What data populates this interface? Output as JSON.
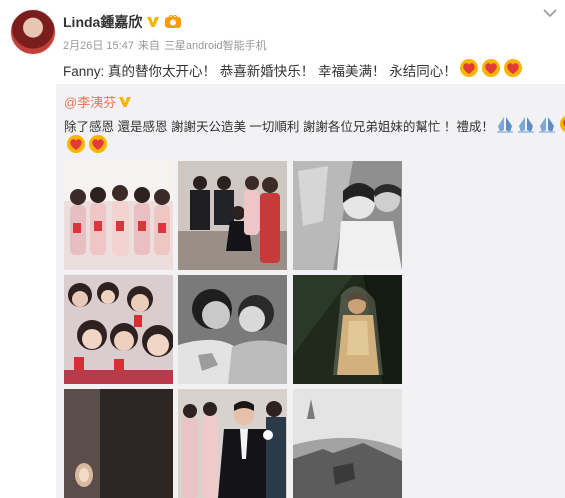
{
  "post": {
    "username": "Linda鍾嘉欣",
    "date": "2月26日 15:47",
    "source_prefix": "来自",
    "source_device": "三星android智能手机",
    "text": "Fanny: 真的替你太开心！ 恭喜新婚快乐！ 幸福美满！ 永结同心！",
    "heart_count": 3
  },
  "repost": {
    "mention": "@李洟芬",
    "text": "除了感恩 還是感恩 謝謝天公造美 一切順利 謝謝各位兄弟姐妹的幫忙 ！禮成！",
    "pray_count": 3,
    "heart_count_inline": 1,
    "heart_count_row": 2
  },
  "photos": [
    {
      "name": "photo-bridesmaids-red-envelopes",
      "icon": "group-photo"
    },
    {
      "name": "photo-groom-kneeling",
      "icon": "group-photo"
    },
    {
      "name": "photo-couple-closeup",
      "icon": "bw-photo"
    },
    {
      "name": "photo-friends-selfie",
      "icon": "group-photo"
    },
    {
      "name": "photo-mother-hug",
      "icon": "bw-photo"
    },
    {
      "name": "photo-bride-veil",
      "icon": "photo"
    },
    {
      "name": "photo-dark-lamp",
      "icon": "photo"
    },
    {
      "name": "photo-groomsmen",
      "icon": "group-photo"
    },
    {
      "name": "photo-bw-landscape",
      "icon": "bw-photo"
    }
  ],
  "colors": {
    "accent": "#eb7350",
    "repost_bg": "#f2f2f5",
    "badge_gold": "#f7b500"
  }
}
